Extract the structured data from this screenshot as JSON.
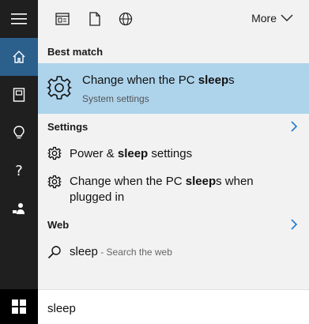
{
  "rail": {
    "items": [
      "hamburger-menu",
      "home",
      "notebook",
      "lightbulb",
      "help",
      "feedback"
    ],
    "active": "home"
  },
  "toolbar": {
    "icons": [
      "apps-icon",
      "document-icon",
      "web-icon"
    ],
    "more_label": "More"
  },
  "best_match": {
    "heading": "Best match",
    "title_prefix": "Change when the PC ",
    "title_bold": "sleep",
    "title_suffix": "s",
    "subtitle": "System settings"
  },
  "settings": {
    "heading": "Settings",
    "items": [
      {
        "pre": "Power & ",
        "bold": "sleep",
        "post": " settings"
      },
      {
        "pre": "Change when the PC ",
        "bold": "sleep",
        "post": "s when plugged in"
      }
    ]
  },
  "web": {
    "heading": "Web",
    "query": "sleep",
    "hint": " - Search the web"
  },
  "search": {
    "value": "sleep"
  },
  "colors": {
    "rail_bg": "#1f1f1f",
    "rail_active": "#2b5f8c",
    "highlight": "#aed4ec",
    "accent": "#1f7ad0"
  }
}
